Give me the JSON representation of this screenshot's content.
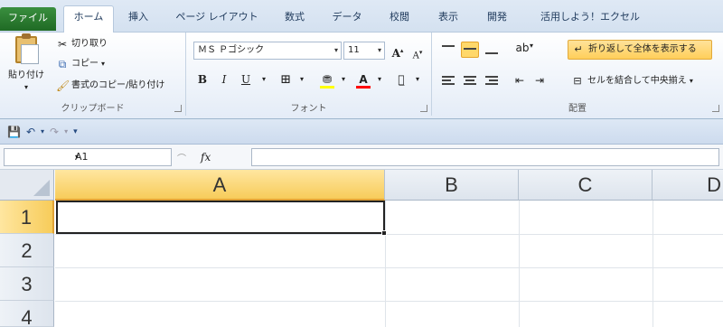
{
  "tabs": {
    "file": "ファイル",
    "home": "ホーム",
    "insert": "挿入",
    "page_layout": "ページ レイアウト",
    "formulas": "数式",
    "data": "データ",
    "review": "校閲",
    "view": "表示",
    "developer": "開発",
    "addin": "活用しよう！エクセル"
  },
  "clipboard": {
    "paste": "貼り付け",
    "cut": "切り取り",
    "copy": "コピー",
    "format_painter": "書式のコピー/貼り付け",
    "group_label": "クリップボード"
  },
  "font": {
    "font_name": "ＭＳ Ｐゴシック",
    "font_size": "11",
    "grow": "A",
    "shrink": "A",
    "bold": "B",
    "italic": "I",
    "underline": "U",
    "fill_color": "#ffff00",
    "font_color": "#ff0000",
    "group_label": "フォント"
  },
  "alignment": {
    "wrap_text": "折り返して全体を表示する",
    "merge_center": "セルを結合して中央揃え",
    "group_label": "配置"
  },
  "namebox": {
    "value": "A1"
  },
  "formula": {
    "fx": "fx",
    "value": ""
  },
  "columns": [
    "A",
    "B",
    "C",
    "D"
  ],
  "rows": [
    "1",
    "2",
    "3",
    "4"
  ],
  "selected_cell": "A1"
}
